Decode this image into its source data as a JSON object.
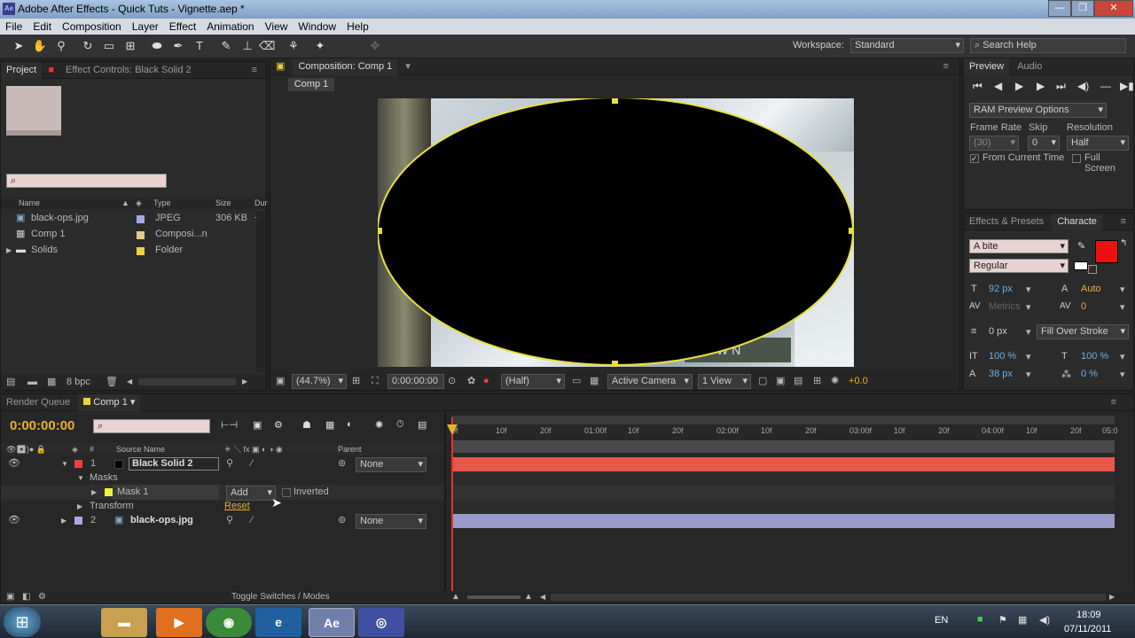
{
  "window": {
    "title": "Adobe After Effects - Quick Tuts - Vignette.aep *",
    "app_icon": "Ae"
  },
  "menu": [
    "File",
    "Edit",
    "Composition",
    "Layer",
    "Effect",
    "Animation",
    "View",
    "Window",
    "Help"
  ],
  "workspace": {
    "label": "Workspace:",
    "value": "Standard",
    "search_placeholder": "Search Help"
  },
  "project": {
    "tabs": [
      "Project",
      "Effect Controls: Black Solid 2"
    ],
    "columns": [
      "Name",
      "Type",
      "Size",
      "Dur"
    ],
    "items": [
      {
        "name": "black-ops.jpg",
        "type": "JPEG",
        "size": "306 KB",
        "label_color": "#a8a8e8"
      },
      {
        "name": "Comp 1",
        "type": "Composi...n",
        "size": "",
        "label_color": "#e8c890"
      },
      {
        "name": "Solids",
        "type": "Folder",
        "size": "",
        "label_color": "#f0d040"
      }
    ],
    "bpc": "8 bpc"
  },
  "composition": {
    "tab": "Composition: Comp 1",
    "subtab": "Comp 1",
    "zoom": "(44.7%)",
    "timecode": "0:00:00:00",
    "resolution": "(Half)",
    "camera": "Active Camera",
    "view": "1 View",
    "exposure": "+0.0",
    "overlay_text": "WN"
  },
  "preview": {
    "tabs": [
      "Preview",
      "Audio"
    ],
    "ram_options": "RAM Preview Options",
    "frame_rate_label": "Frame Rate",
    "skip_label": "Skip",
    "resolution_label": "Resolution",
    "frame_rate": "(30)",
    "skip": "0",
    "resolution": "Half",
    "from_current": "From Current Time",
    "full_screen": "Full Screen"
  },
  "character": {
    "tabs": [
      "Effects & Presets",
      "Characte"
    ],
    "font": "A bite",
    "style": "Regular",
    "size": "92 px",
    "leading": "Auto",
    "kerning": "Metrics",
    "tracking": "0",
    "stroke_width": "0 px",
    "stroke_mode": "Fill Over Stroke",
    "vscale": "100 %",
    "hscale": "100 %",
    "baseline": "38 px",
    "tsume": "0 %",
    "fill_color": "#ee1010"
  },
  "timeline": {
    "tabs": [
      "Render Queue",
      "Comp 1"
    ],
    "timecode": "0:00:00:00",
    "source_name_header": "Source Name",
    "parent_header": "Parent",
    "layers": [
      {
        "num": "1",
        "name": "Black Solid 2",
        "parent": "None",
        "color": "#e84040"
      },
      {
        "num": "2",
        "name": "black-ops.jpg",
        "parent": "None",
        "color": "#a8a8e8"
      }
    ],
    "masks_label": "Masks",
    "mask_name": "Mask 1",
    "mask_mode": "Add",
    "inverted": "Inverted",
    "transform": "Transform",
    "reset": "Reset",
    "toggle": "Toggle Switches / Modes",
    "ruler": [
      "0f",
      "10f",
      "20f",
      "01:00f",
      "10f",
      "20f",
      "02:00f",
      "10f",
      "20f",
      "03:00f",
      "10f",
      "20f",
      "04:00f",
      "10f",
      "20f",
      "05:0"
    ]
  },
  "taskbar": {
    "lang": "EN",
    "time": "18:09",
    "date": "07/11/2011"
  }
}
